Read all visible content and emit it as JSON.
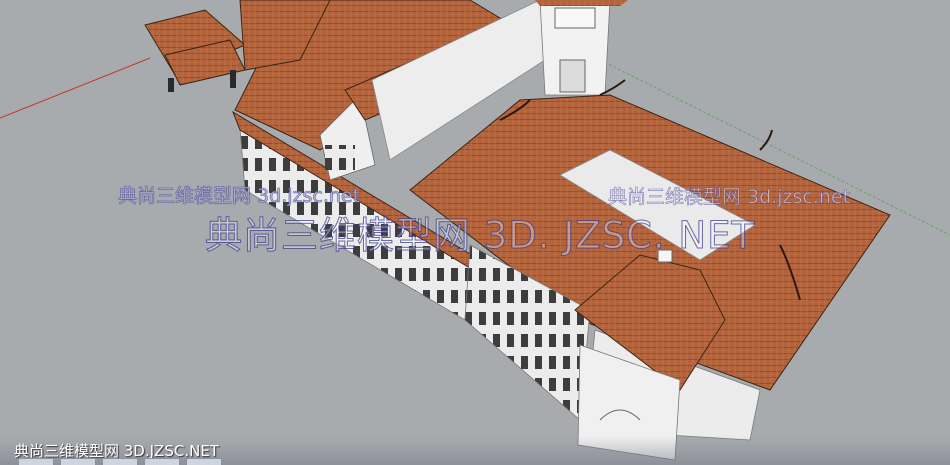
{
  "app": {
    "viewport_background": "#a8abad"
  },
  "model": {
    "roof_color": "#b4643c",
    "wall_color": "#ebebeb",
    "window_color": "#3a3a3a",
    "axis_red": "#c0392b",
    "axis_green": "#5e8f5e"
  },
  "watermarks": {
    "left": "典尚三维模型网 3d.jzsc.net",
    "right": "典尚三维模型网 3d.jzsc.net",
    "center": "典尚三维模型网 3D. JZSC. NET",
    "bottom": "典尚三维模型网 3D.JZSC.NET"
  }
}
